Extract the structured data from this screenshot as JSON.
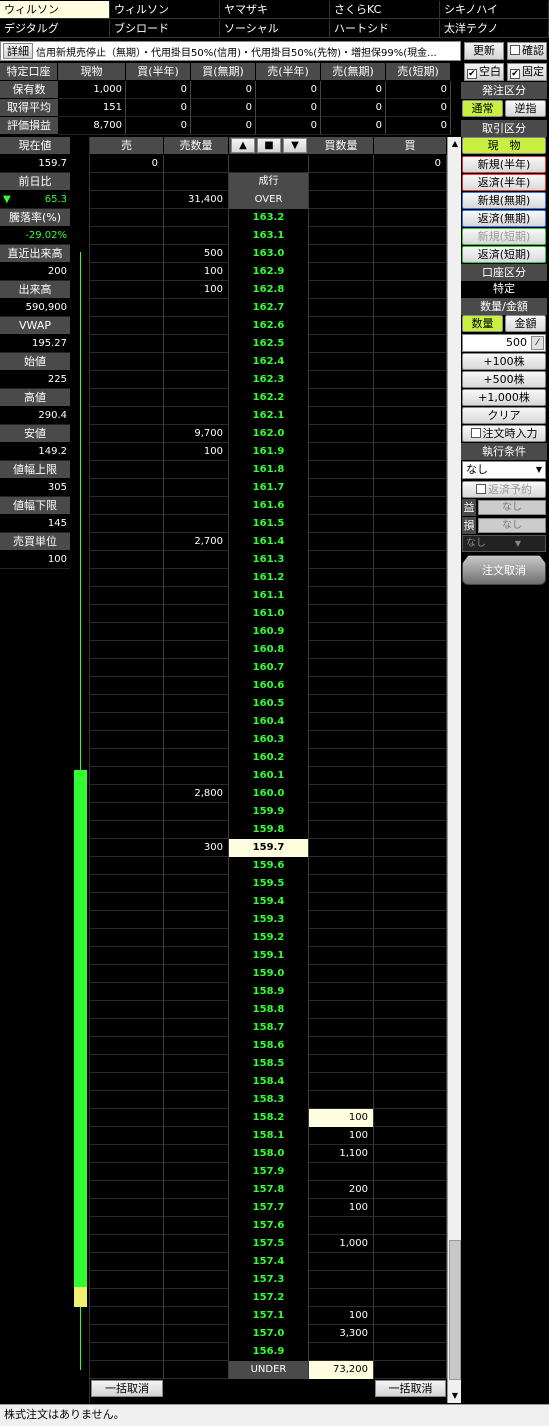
{
  "tabs": [
    {
      "label": "ウィルソン",
      "active": true
    },
    {
      "label": "ウィルソン",
      "active": false
    },
    {
      "label": "ヤマザキ",
      "active": false
    },
    {
      "label": "さくらKC",
      "active": false
    },
    {
      "label": "シキノハイ",
      "active": false
    },
    {
      "label": "デジタルグ",
      "active": false
    },
    {
      "label": "ブシロード",
      "active": false
    },
    {
      "label": "ソーシャル",
      "active": false
    },
    {
      "label": "ハートシド",
      "active": false
    },
    {
      "label": "太洋テクノ",
      "active": false
    }
  ],
  "info": {
    "detail_label": "詳細",
    "text": "信用新規売停止（無期）・代用掛目50%(信用)・代用掛目50%(先物)・増担保99%(現金..."
  },
  "top_buttons": {
    "refresh": "更新",
    "confirm": "確認",
    "blank": "空白",
    "fixed": "固定"
  },
  "positions": {
    "headers": [
      "特定口座",
      "現物",
      "買(半年)",
      "買(無期)",
      "売(半年)",
      "売(無期)",
      "売(短期)"
    ],
    "rows": [
      {
        "label": "保有数",
        "values": [
          "1,000",
          "0",
          "0",
          "0",
          "0",
          "0"
        ]
      },
      {
        "label": "取得平均",
        "values": [
          "151",
          "0",
          "0",
          "0",
          "0",
          "0"
        ]
      },
      {
        "label": "評価損益",
        "values": [
          "8,700",
          "0",
          "0",
          "0",
          "0",
          "0"
        ]
      }
    ]
  },
  "stats": [
    {
      "label": "現在値",
      "value": "159.7",
      "color": "white"
    },
    {
      "label": "前日比",
      "value": "65.3",
      "color": "green",
      "arrow": "▼"
    },
    {
      "label": "騰落率(%)",
      "value": "-29.02%",
      "color": "green"
    },
    {
      "label": "直近出来高",
      "value": "200",
      "color": "white"
    },
    {
      "label": "出来高",
      "value": "590,900",
      "color": "white"
    },
    {
      "label": "VWAP",
      "value": "195.27",
      "color": "white"
    },
    {
      "label": "始値",
      "value": "225",
      "color": "white"
    },
    {
      "label": "高値",
      "value": "290.4",
      "color": "white"
    },
    {
      "label": "安値",
      "value": "149.2",
      "color": "white"
    },
    {
      "label": "値幅上限",
      "value": "305",
      "color": "white"
    },
    {
      "label": "値幅下限",
      "value": "145",
      "color": "white"
    },
    {
      "label": "売買単位",
      "value": "100",
      "color": "white"
    }
  ],
  "board": {
    "headers": {
      "sell": "売",
      "sell_qty": "売数量",
      "buy_qty": "買数量",
      "buy": "買"
    },
    "scroll_buttons": [
      "▲",
      "■",
      "▼"
    ],
    "sell_total": "0",
    "buy_total": "0",
    "market_label": "成行",
    "over": {
      "label": "OVER",
      "sell_qty": "31,400"
    },
    "under": {
      "label": "UNDER",
      "buy_qty": "73,200"
    },
    "current_price": "159.7",
    "levels": [
      {
        "price": "163.2",
        "sell": "",
        "buy": ""
      },
      {
        "price": "163.1",
        "sell": "",
        "buy": ""
      },
      {
        "price": "163.0",
        "sell": "500",
        "buy": ""
      },
      {
        "price": "162.9",
        "sell": "100",
        "buy": ""
      },
      {
        "price": "162.8",
        "sell": "100",
        "buy": ""
      },
      {
        "price": "162.7",
        "sell": "",
        "buy": ""
      },
      {
        "price": "162.6",
        "sell": "",
        "buy": ""
      },
      {
        "price": "162.5",
        "sell": "",
        "buy": ""
      },
      {
        "price": "162.4",
        "sell": "",
        "buy": ""
      },
      {
        "price": "162.3",
        "sell": "",
        "buy": ""
      },
      {
        "price": "162.2",
        "sell": "",
        "buy": ""
      },
      {
        "price": "162.1",
        "sell": "",
        "buy": ""
      },
      {
        "price": "162.0",
        "sell": "9,700",
        "buy": ""
      },
      {
        "price": "161.9",
        "sell": "100",
        "buy": ""
      },
      {
        "price": "161.8",
        "sell": "",
        "buy": ""
      },
      {
        "price": "161.7",
        "sell": "",
        "buy": ""
      },
      {
        "price": "161.6",
        "sell": "",
        "buy": ""
      },
      {
        "price": "161.5",
        "sell": "",
        "buy": ""
      },
      {
        "price": "161.4",
        "sell": "2,700",
        "buy": ""
      },
      {
        "price": "161.3",
        "sell": "",
        "buy": ""
      },
      {
        "price": "161.2",
        "sell": "",
        "buy": ""
      },
      {
        "price": "161.1",
        "sell": "",
        "buy": ""
      },
      {
        "price": "161.0",
        "sell": "",
        "buy": ""
      },
      {
        "price": "160.9",
        "sell": "",
        "buy": ""
      },
      {
        "price": "160.8",
        "sell": "",
        "buy": ""
      },
      {
        "price": "160.7",
        "sell": "",
        "buy": ""
      },
      {
        "price": "160.6",
        "sell": "",
        "buy": ""
      },
      {
        "price": "160.5",
        "sell": "",
        "buy": ""
      },
      {
        "price": "160.4",
        "sell": "",
        "buy": ""
      },
      {
        "price": "160.3",
        "sell": "",
        "buy": ""
      },
      {
        "price": "160.2",
        "sell": "",
        "buy": ""
      },
      {
        "price": "160.1",
        "sell": "",
        "buy": ""
      },
      {
        "price": "160.0",
        "sell": "2,800",
        "buy": ""
      },
      {
        "price": "159.9",
        "sell": "",
        "buy": ""
      },
      {
        "price": "159.8",
        "sell": "",
        "buy": ""
      },
      {
        "price": "159.7",
        "sell": "300",
        "buy": ""
      },
      {
        "price": "159.6",
        "sell": "",
        "buy": ""
      },
      {
        "price": "159.5",
        "sell": "",
        "buy": ""
      },
      {
        "price": "159.4",
        "sell": "",
        "buy": ""
      },
      {
        "price": "159.3",
        "sell": "",
        "buy": ""
      },
      {
        "price": "159.2",
        "sell": "",
        "buy": ""
      },
      {
        "price": "159.1",
        "sell": "",
        "buy": ""
      },
      {
        "price": "159.0",
        "sell": "",
        "buy": ""
      },
      {
        "price": "158.9",
        "sell": "",
        "buy": ""
      },
      {
        "price": "158.8",
        "sell": "",
        "buy": ""
      },
      {
        "price": "158.7",
        "sell": "",
        "buy": ""
      },
      {
        "price": "158.6",
        "sell": "",
        "buy": ""
      },
      {
        "price": "158.5",
        "sell": "",
        "buy": ""
      },
      {
        "price": "158.4",
        "sell": "",
        "buy": ""
      },
      {
        "price": "158.3",
        "sell": "",
        "buy": ""
      },
      {
        "price": "158.2",
        "sell": "",
        "buy": "100"
      },
      {
        "price": "158.1",
        "sell": "",
        "buy": "100"
      },
      {
        "price": "158.0",
        "sell": "",
        "buy": "1,100"
      },
      {
        "price": "157.9",
        "sell": "",
        "buy": ""
      },
      {
        "price": "157.8",
        "sell": "",
        "buy": "200"
      },
      {
        "price": "157.7",
        "sell": "",
        "buy": "100"
      },
      {
        "price": "157.6",
        "sell": "",
        "buy": ""
      },
      {
        "price": "157.5",
        "sell": "",
        "buy": "1,000"
      },
      {
        "price": "157.4",
        "sell": "",
        "buy": ""
      },
      {
        "price": "157.3",
        "sell": "",
        "buy": ""
      },
      {
        "price": "157.2",
        "sell": "",
        "buy": ""
      },
      {
        "price": "157.1",
        "sell": "",
        "buy": "100"
      },
      {
        "price": "157.0",
        "sell": "",
        "buy": "3,300"
      },
      {
        "price": "156.9",
        "sell": "",
        "buy": ""
      }
    ],
    "cancel_all_sell": "一括取消",
    "cancel_all_buy": "一括取消"
  },
  "right": {
    "order_section": "発注区分",
    "normal": "通常",
    "reverse": "逆指",
    "trade_section": "取引区分",
    "spot": "現　物",
    "trade_buttons": [
      {
        "label": "新規(半年)",
        "border": "#e04040"
      },
      {
        "label": "返済(半年)",
        "border": "#e04040"
      },
      {
        "label": "新規(無期)",
        "border": "#3a7ae0"
      },
      {
        "label": "返済(無期)",
        "border": "#3a7ae0"
      },
      {
        "label": "新規(短期)",
        "border": "#40c040",
        "disabled": true
      },
      {
        "label": "返済(短期)",
        "border": "#40c040"
      }
    ],
    "account_section": "口座区分",
    "account_value": "特定",
    "qty_section": "数量/金額",
    "qty": "数量",
    "amount": "金額",
    "qty_value": "500",
    "add_buttons": [
      "+100株",
      "+500株",
      "+1,000株"
    ],
    "clear": "クリア",
    "order_time_input": "注文時入力",
    "exec_section": "執行条件",
    "exec_value": "なし",
    "repay_reserve": "返済予約",
    "profit_label": "益",
    "loss_label": "損",
    "none": "なし",
    "cancel_order": "注文取消"
  },
  "status_text": "株式注文はありません。",
  "colors": {
    "accent_green": "#32ff32",
    "highlight": "#fffde0",
    "selected_green": "#c8f040"
  }
}
